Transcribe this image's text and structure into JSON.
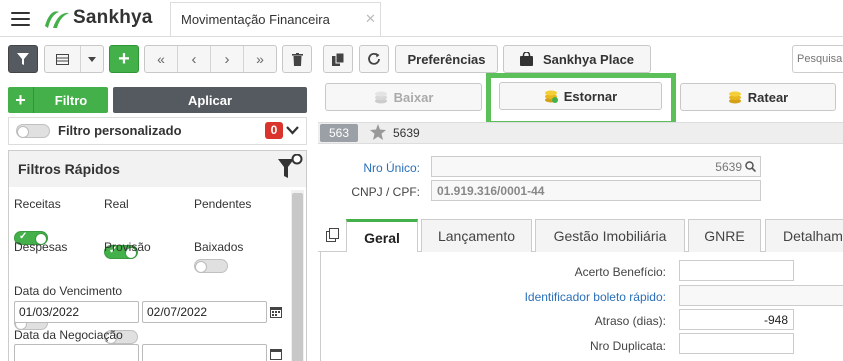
{
  "app": {
    "brand": "Sankhya",
    "tab_title": "Movimentação Financeira",
    "tab_close": "✕"
  },
  "toolbar": {
    "preferences_label": "Preferências",
    "place_label": "Sankhya Place",
    "search_placeholder": "Pesquisar"
  },
  "filters": {
    "filter_button": "Filtro",
    "apply_button": "Aplicar",
    "custom_filter_label": "Filtro personalizado",
    "custom_filter_count": "0",
    "quick_filters_title": "Filtros Rápidos",
    "toggles": [
      {
        "label": "Receitas",
        "on": true
      },
      {
        "label": "Real",
        "on": true
      },
      {
        "label": "Pendentes",
        "on": false
      },
      {
        "label": "Despesas",
        "on": false
      },
      {
        "label": "Provisão",
        "on": false
      },
      {
        "label": "Baixados",
        "on": true
      }
    ],
    "due_date_label": "Data do Vencimento",
    "due_date_from": "01/03/2022",
    "due_date_to": "02/07/2022",
    "negotiation_date_label": "Data da Negociação",
    "negotiation_date_from": "",
    "negotiation_date_to": ""
  },
  "actions": {
    "baixar": "Baixar",
    "estornar": "Estornar",
    "ratear": "Ratear"
  },
  "record": {
    "count": "563",
    "current": "5639",
    "nro_unico_label": "Nro Único:",
    "nro_unico_value": "5639",
    "cnpj_label": "CNPJ / CPF:",
    "cnpj_value": "01.919.316/0001-44"
  },
  "tabs": [
    "Geral",
    "Lançamento",
    "Gestão Imobiliária",
    "GNRE",
    "Detalhamento"
  ],
  "form": {
    "acerto_label": "Acerto Benefício:",
    "acerto_value": "",
    "boleto_label": "Identificador boleto rápido:",
    "boleto_value": "",
    "atraso_label": "Atraso (dias):",
    "atraso_value": "-948",
    "duplicata_label": "Nro Duplicata:",
    "duplicata_value": ""
  },
  "colors": {
    "accent_green": "#43b04a",
    "dark_button": "#555a60",
    "link_blue": "#2a6fb8",
    "badge_red": "#d9332b"
  }
}
